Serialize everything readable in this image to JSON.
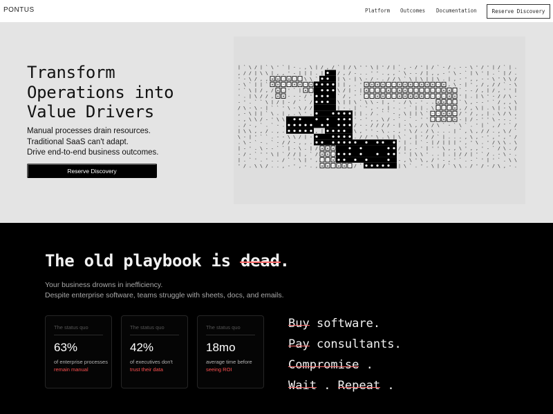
{
  "nav": {
    "brand": "PONTUS",
    "links": [
      "Platform",
      "Outcomes",
      "Documentation"
    ],
    "cta": "Reserve Discovery"
  },
  "hero": {
    "title": "Transform\nOperations into\nValue Drivers",
    "subtitle_lines": [
      "Manual processes drain resources.",
      "Traditional SaaS can't adapt.",
      "Drive end-to-end business outcomes."
    ],
    "button": "Reserve Discovery",
    "visual_icon": "ascii-pixel-art-pattern"
  },
  "problem": {
    "title_prefix": "The old playbook is ",
    "title_struck": "dead",
    "title_suffix": ".",
    "subtitle_lines": [
      "Your business drowns in inefficiency.",
      "Despite enterprise software, teams struggle with sheets, docs, and emails."
    ],
    "stats": [
      {
        "label": "The status quo",
        "value": "63%",
        "desc": "of enterprise processes",
        "highlight": "remain manual"
      },
      {
        "label": "The status quo",
        "value": "42%",
        "desc": "of executives don't",
        "highlight": "trust their data"
      },
      {
        "label": "The status quo",
        "value": "18mo",
        "desc": "average time before",
        "highlight": "seeing ROI"
      }
    ],
    "playbook": {
      "line1_struck": "Buy",
      "line1_rest": " software.",
      "line2_struck": "Pay",
      "line2_rest": " consultants.",
      "line3_struck": "Compromise",
      "line3_rest": " .",
      "line4_a_struck": "Wait",
      "line4_a_rest": " . ",
      "line4_b_struck": "Repeat",
      "line4_b_rest": " ."
    }
  },
  "colors": {
    "accent_red": "#ff5050",
    "strike_red": "#ff6b6b",
    "hero_bg": "#e4e4e4",
    "dark_bg": "#000000"
  }
}
